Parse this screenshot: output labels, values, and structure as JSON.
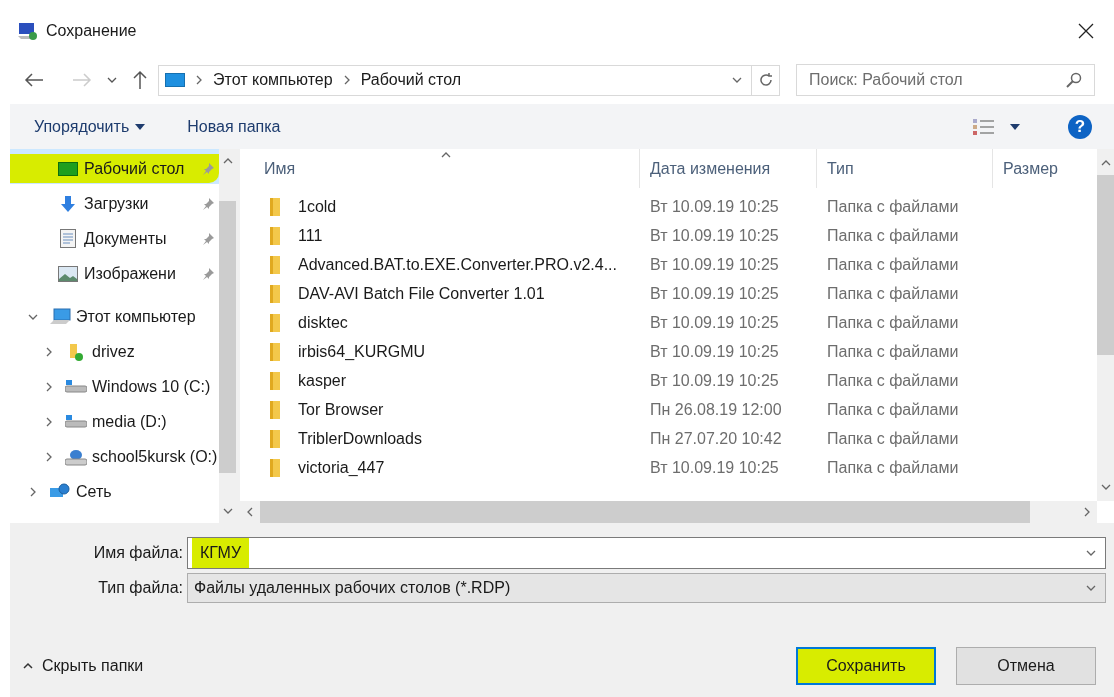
{
  "window": {
    "title": "Сохранение"
  },
  "address": {
    "path": [
      "Этот компьютер",
      "Рабочий стол"
    ]
  },
  "search": {
    "placeholder": "Поиск: Рабочий стол"
  },
  "toolbar": {
    "organize": "Упорядочить",
    "new_folder": "Новая папка",
    "help": "?"
  },
  "sidebar": {
    "quick_access": [
      {
        "label": "Рабочий стол",
        "kind": "desktop",
        "selected": true,
        "highlighted": true
      },
      {
        "label": "Загрузки",
        "kind": "download",
        "selected": false,
        "highlighted": false
      },
      {
        "label": "Документы",
        "kind": "document",
        "selected": false,
        "highlighted": false
      },
      {
        "label": "Изображени",
        "kind": "image",
        "selected": false,
        "highlighted": false
      }
    ],
    "tree": [
      {
        "label": "Этот компьютер",
        "kind": "computer",
        "expanded": true,
        "children": [
          {
            "label": "drivez",
            "kind": "folder",
            "expanded": false
          },
          {
            "label": "Windows 10 (C:)",
            "kind": "drive",
            "expanded": false
          },
          {
            "label": "media (D:)",
            "kind": "drive",
            "expanded": false
          },
          {
            "label": "school5kursk (O:)",
            "kind": "netdrive",
            "expanded": false
          }
        ]
      },
      {
        "label": "Сеть",
        "kind": "network",
        "expanded": false
      }
    ]
  },
  "table": {
    "columns": [
      "Имя",
      "Дата изменения",
      "Тип",
      "Размер"
    ],
    "rows": [
      {
        "name": "1cold",
        "date": "Вт 10.09.19 10:25",
        "type": "Папка с файлами"
      },
      {
        "name": "111",
        "date": "Вт 10.09.19 10:25",
        "type": "Папка с файлами"
      },
      {
        "name": "Advanced.BAT.to.EXE.Converter.PRO.v2.4...",
        "date": "Вт 10.09.19 10:25",
        "type": "Папка с файлами"
      },
      {
        "name": "DAV-AVI Batch File Converter 1.01",
        "date": "Вт 10.09.19 10:25",
        "type": "Папка с файлами"
      },
      {
        "name": "disktec",
        "date": "Вт 10.09.19 10:25",
        "type": "Папка с файлами"
      },
      {
        "name": "irbis64_KURGMU",
        "date": "Вт 10.09.19 10:25",
        "type": "Папка с файлами"
      },
      {
        "name": "kasper",
        "date": "Вт 10.09.19 10:25",
        "type": "Папка с файлами"
      },
      {
        "name": "Tor Browser",
        "date": "Пн 26.08.19 12:00",
        "type": "Папка с файлами"
      },
      {
        "name": "TriblerDownloads",
        "date": "Пн 27.07.20 10:42",
        "type": "Папка с файлами"
      },
      {
        "name": "victoria_447",
        "date": "Вт 10.09.19 10:25",
        "type": "Папка с файлами"
      }
    ]
  },
  "filename": {
    "label": "Имя файла:",
    "value": "КГМУ",
    "highlighted": true
  },
  "filetype": {
    "label": "Тип файла:",
    "value": "Файлы удаленных рабочих столов (*.RDP)"
  },
  "hide_folders": "Скрыть папки",
  "buttons": [
    {
      "label": "Сохранить",
      "kind": "primary",
      "highlighted": true
    },
    {
      "label": "Отмена",
      "kind": "secondary",
      "highlighted": false
    }
  ]
}
